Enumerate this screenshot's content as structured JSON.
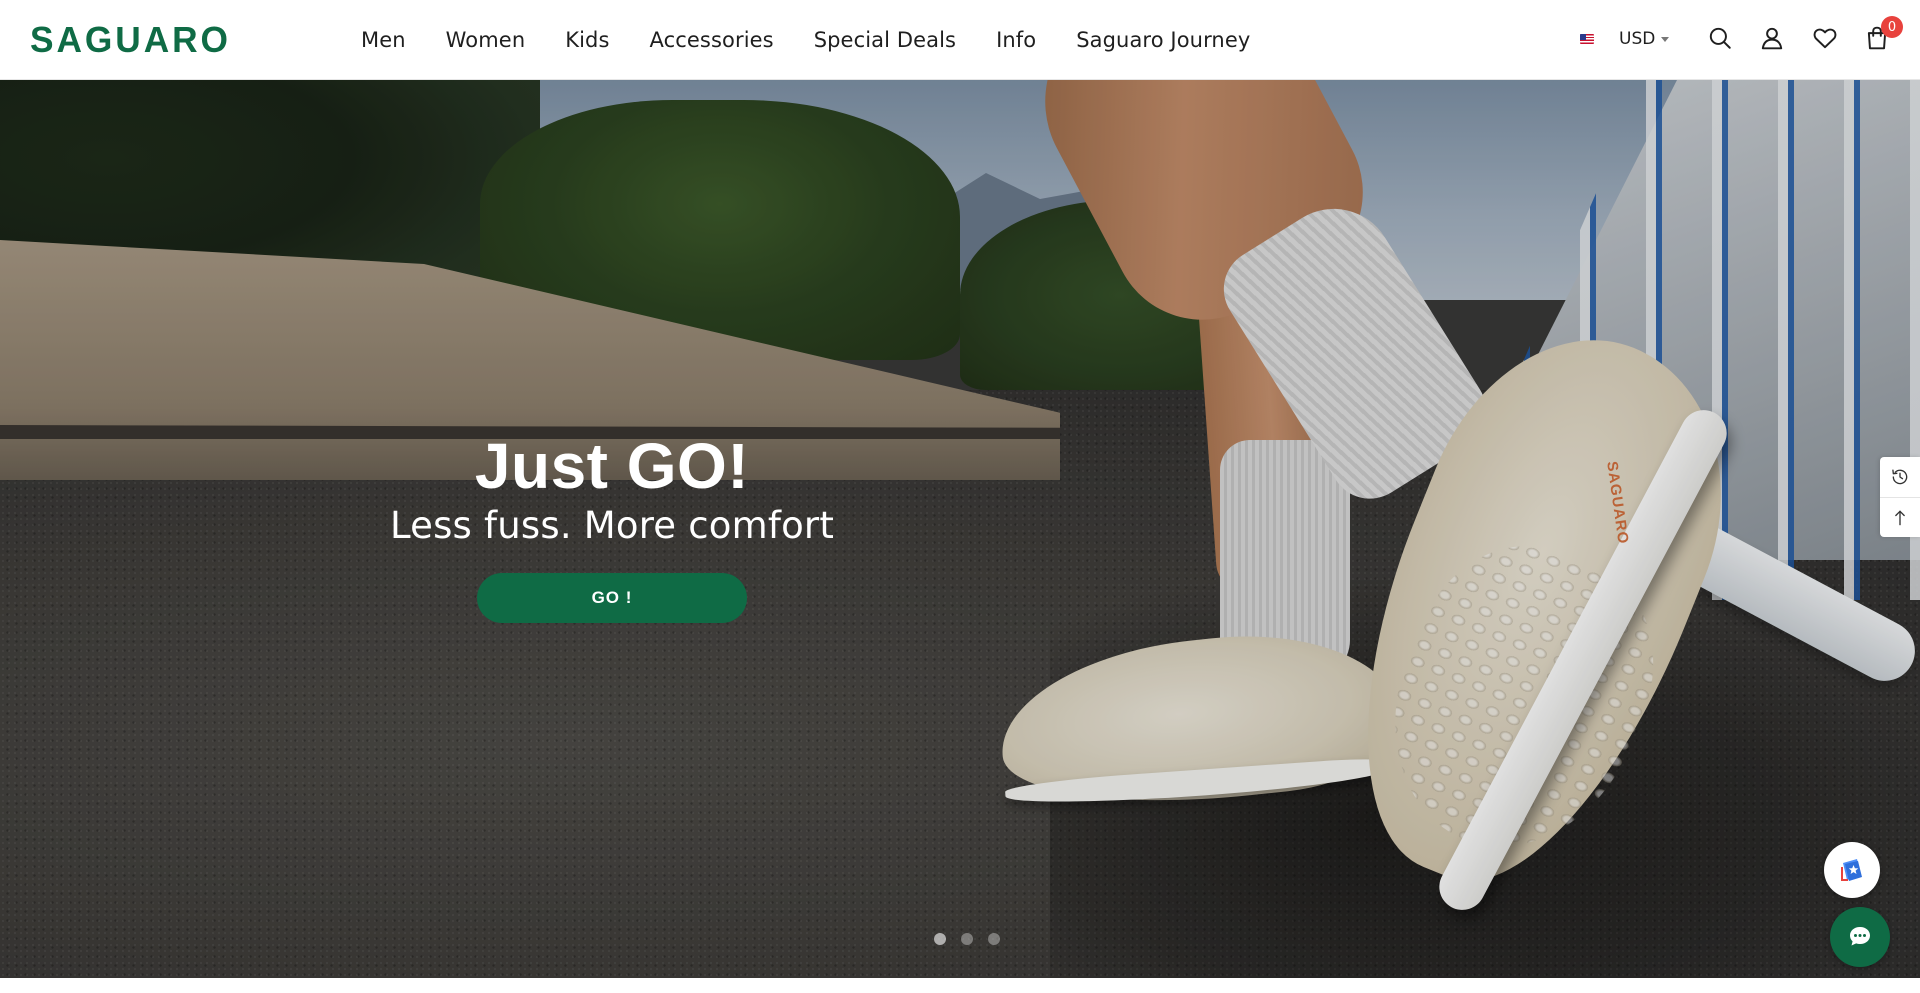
{
  "header": {
    "logo_text": "SAGUARO",
    "nav": [
      "Men",
      "Women",
      "Kids",
      "Accessories",
      "Special Deals",
      "Info",
      "Saguaro Journey"
    ],
    "currency": "USD",
    "cart_count": "0",
    "icons": [
      "search-icon",
      "account-icon",
      "wishlist-icon",
      "cart-icon"
    ]
  },
  "hero": {
    "title": "Just GO!",
    "subtitle": "Less fuss. More comfort",
    "button_label": "GO !",
    "shoe_brand_mark": "SAGUARO",
    "slides_count": 3,
    "active_slide": 1
  },
  "side_tools": [
    "recently-viewed-icon",
    "back-to-top-icon"
  ],
  "floating": [
    "reviews-widget-icon",
    "chat-icon"
  ],
  "colors": {
    "brand_green": "#0f6b45",
    "badge_red": "#e8423d"
  }
}
